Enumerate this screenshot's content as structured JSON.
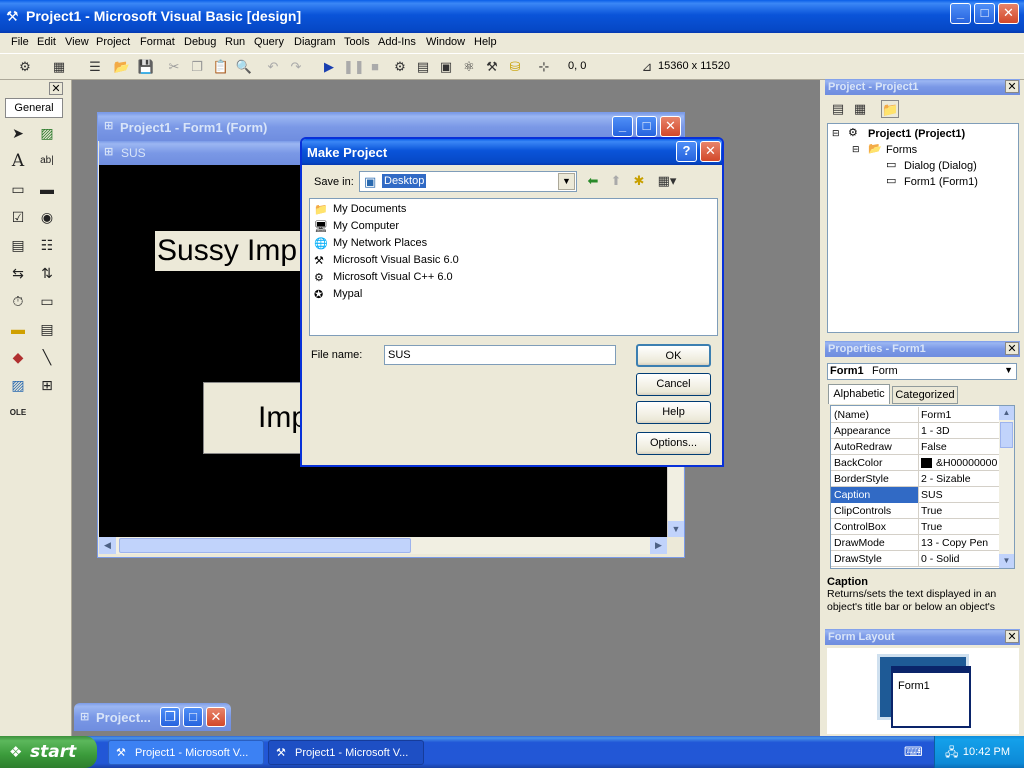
{
  "app": {
    "title": "Project1 - Microsoft Visual Basic [design]"
  },
  "menu": [
    "File",
    "Edit",
    "View",
    "Project",
    "Format",
    "Debug",
    "Run",
    "Query",
    "Diagram",
    "Tools",
    "Add-Ins",
    "Window",
    "Help"
  ],
  "toolbar": {
    "position": "0, 0",
    "size": "15360 x 11520"
  },
  "toolbox": {
    "tab": "General"
  },
  "form_window": {
    "title": "Project1 - Form1 (Form)",
    "caption": "SUS",
    "label1": "Sussy Imp",
    "button1": "Imp"
  },
  "minimized_window": {
    "title": "Project..."
  },
  "dialog": {
    "title": "Make Project",
    "save_in_label": "Save in:",
    "save_in_value": "Desktop",
    "files": [
      "My Documents",
      "My Computer",
      "My Network Places",
      "Microsoft Visual Basic 6.0",
      "Microsoft Visual C++ 6.0",
      "Mypal"
    ],
    "file_name_label": "File name:",
    "file_name_value": "SUS",
    "ok": "OK",
    "cancel": "Cancel",
    "help": "Help",
    "options": "Options..."
  },
  "project_panel": {
    "title": "Project - Project1",
    "root": "Project1 (Project1)",
    "folder": "Forms",
    "items": [
      "Dialog (Dialog)",
      "Form1 (Form1)"
    ]
  },
  "properties_panel": {
    "title": "Properties - Form1",
    "object": "Form1",
    "object_type": "Form",
    "tabs": [
      "Alphabetic",
      "Categorized"
    ],
    "rows": [
      {
        "name": "(Name)",
        "value": "Form1"
      },
      {
        "name": "Appearance",
        "value": "1 - 3D"
      },
      {
        "name": "AutoRedraw",
        "value": "False"
      },
      {
        "name": "BackColor",
        "value": "&H00000000"
      },
      {
        "name": "BorderStyle",
        "value": "2 - Sizable"
      },
      {
        "name": "Caption",
        "value": "SUS"
      },
      {
        "name": "ClipControls",
        "value": "True"
      },
      {
        "name": "ControlBox",
        "value": "True"
      },
      {
        "name": "DrawMode",
        "value": "13 - Copy Pen"
      },
      {
        "name": "DrawStyle",
        "value": "0 - Solid"
      }
    ],
    "desc_title": "Caption",
    "desc_text": "Returns/sets the text displayed in an object's title bar or below an object's"
  },
  "form_layout_panel": {
    "title": "Form Layout",
    "form_label": "Form1"
  },
  "taskbar": {
    "start": "start",
    "tasks": [
      "Project1 - Microsoft V...",
      "Project1 - Microsoft V..."
    ],
    "time": "10:42 PM"
  }
}
